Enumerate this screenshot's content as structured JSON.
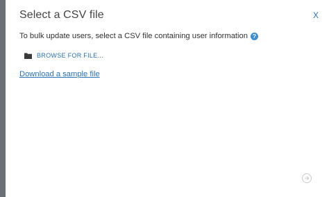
{
  "dialog": {
    "title": "Select a CSV file",
    "close_label": "X",
    "instruction": "To bulk update users, select a CSV file containing user information",
    "help_glyph": "?",
    "browse_label": "BROWSE FOR FILE...",
    "sample_link": "Download a sample file"
  },
  "icons": {
    "help": "question-circle-icon",
    "browse": "folder-icon",
    "next": "arrow-right-circle-icon"
  },
  "colors": {
    "accent": "#2a72b5",
    "rail": "#6a7076",
    "help_bg": "#3d8fd1"
  }
}
